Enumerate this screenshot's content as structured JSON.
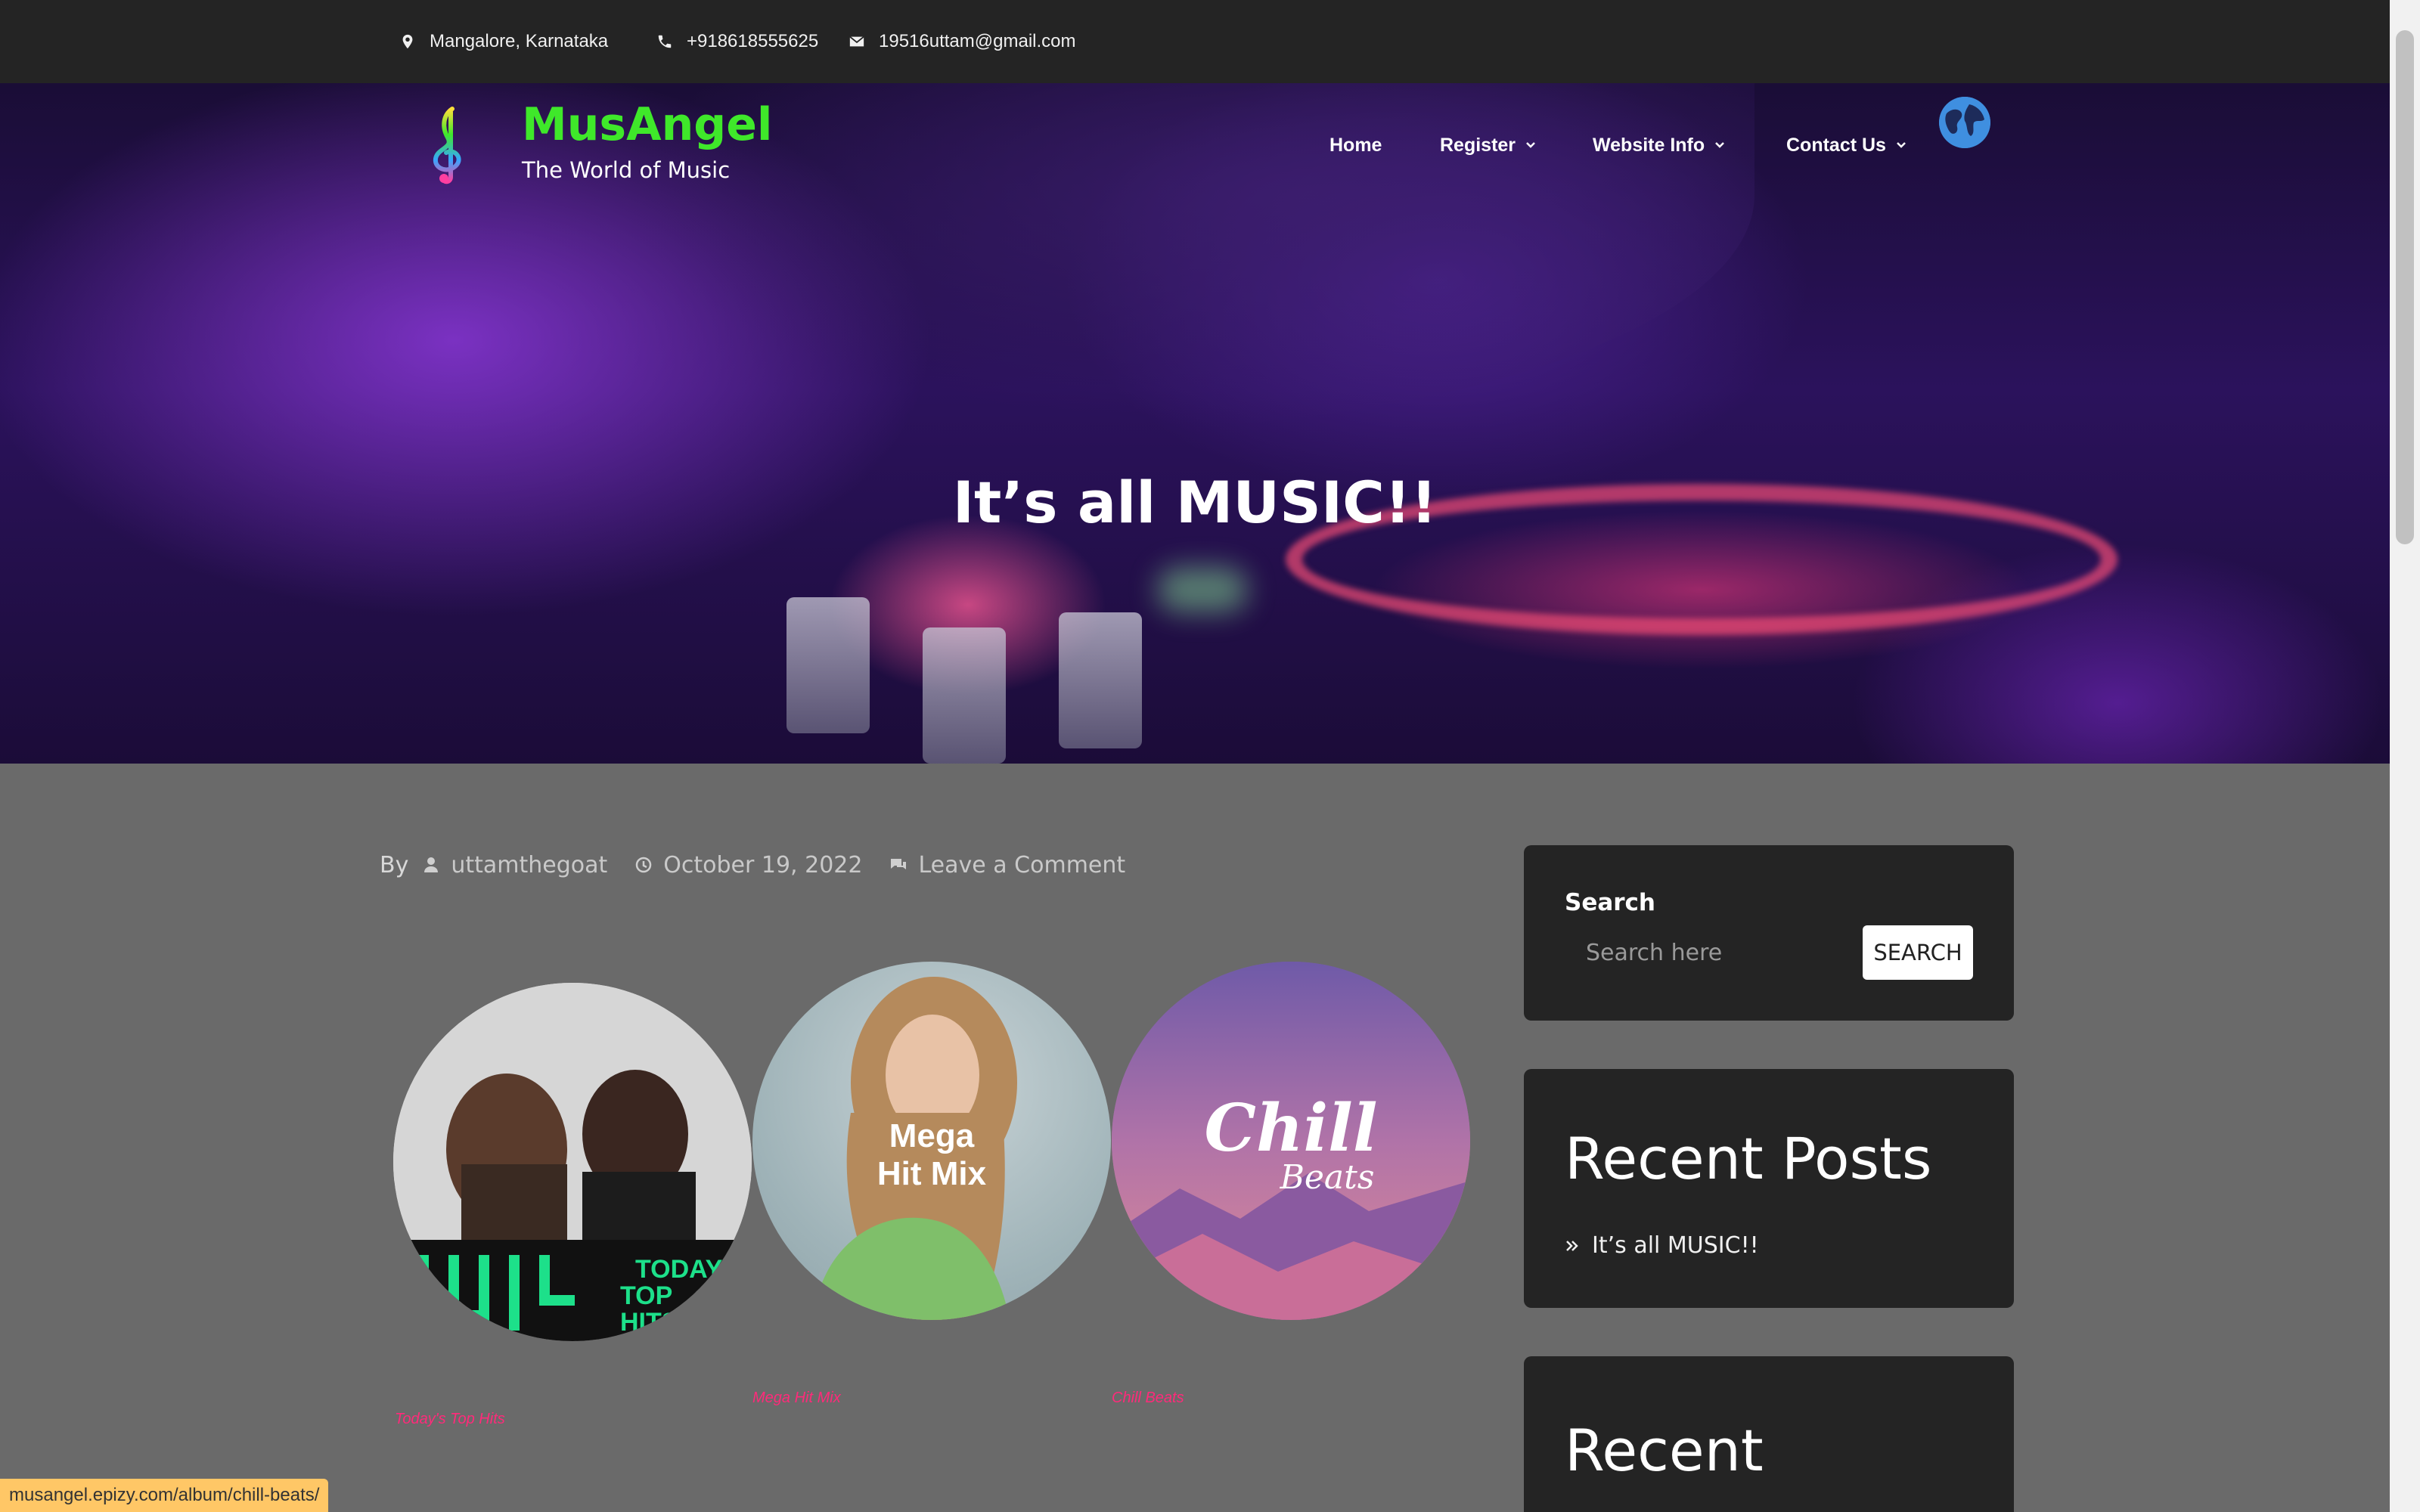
{
  "topbar": {
    "location": "Mangalore, Karnataka",
    "phone": "+918618555625",
    "email": "19516uttam@gmail.com"
  },
  "brand": {
    "name": "MusAngel",
    "tagline": "The World of Music",
    "logo_icon": "treble-clef-icon",
    "name_color": "#3fe82a"
  },
  "nav": {
    "items": [
      {
        "label": "Home"
      },
      {
        "label": "Register"
      },
      {
        "label": "Website Info"
      },
      {
        "label": "Contact Us"
      }
    ]
  },
  "hero": {
    "title": "It’s all MUSIC!!"
  },
  "post_meta": {
    "by_label": "By",
    "author": "uttamthegoat",
    "date": "October 19, 2022",
    "comment_link": "Leave a Comment"
  },
  "albums": [
    {
      "overlay_text": "TODAY TOP HITS",
      "caption": "Today's Top Hits"
    },
    {
      "overlay_text": "Mega Hit Mix",
      "caption": "Mega Hit Mix"
    },
    {
      "overlay_text": "Chill Beats",
      "caption": "Chill Beats"
    }
  ],
  "sidebar": {
    "search": {
      "label": "Search",
      "placeholder": "Search here",
      "button": "SEARCH"
    },
    "recent_posts": {
      "title": "Recent Posts",
      "items": [
        "It’s all MUSIC!!"
      ]
    },
    "recent_comments": {
      "title": "Recent"
    }
  },
  "status_bar": {
    "url": "musangel.epizy.com/album/chill-beats/"
  },
  "colors": {
    "accent_pink": "#ff2a7a",
    "dark_panel": "#242424",
    "page_bg": "#6a6a6a"
  }
}
